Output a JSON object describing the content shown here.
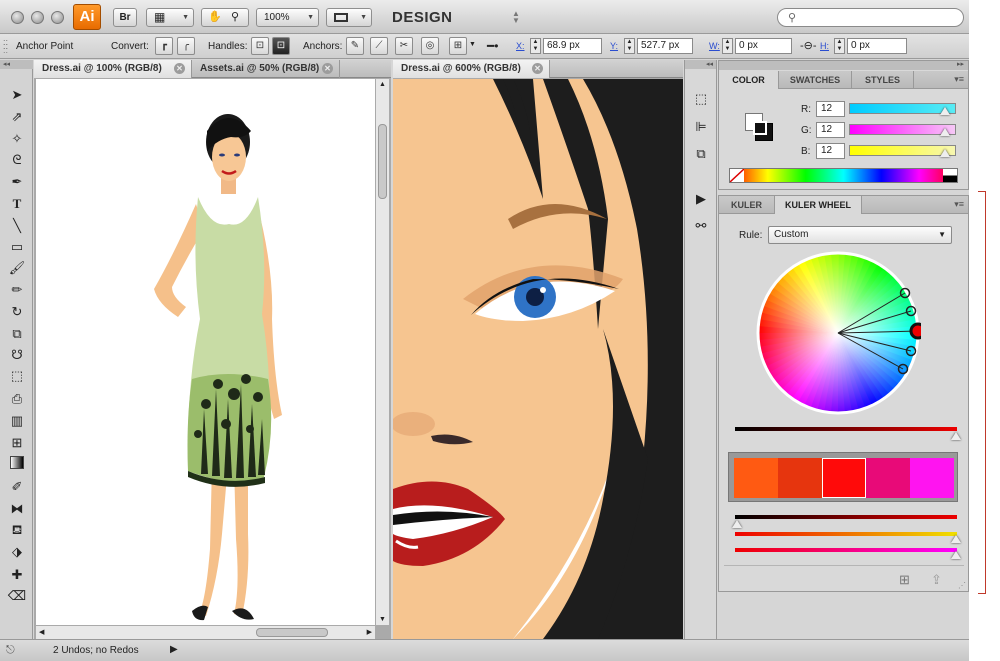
{
  "app": {
    "logo": "Ai",
    "bridge": "Br",
    "zoom": "100%",
    "workspace": "DESIGN",
    "search_placeholder": ""
  },
  "control_bar": {
    "anchor_point": "Anchor Point",
    "convert": "Convert:",
    "handles": "Handles:",
    "anchors": "Anchors:",
    "x_label": "X:",
    "x_value": "68.9 px",
    "y_label": "Y:",
    "y_value": "527.7 px",
    "w_label": "W:",
    "w_value": "0 px",
    "h_label": "H:",
    "h_value": "0 px"
  },
  "documents": [
    {
      "tab": "Dress.ai @ 100% (RGB/8)"
    },
    {
      "tab": "Assets.ai @ 50% (RGB/8)"
    },
    {
      "tab": "Dress.ai @ 600% (RGB/8)"
    }
  ],
  "color_panel": {
    "tabs": [
      "COLOR",
      "SWATCHES",
      "STYLES"
    ],
    "channels": [
      {
        "label": "R:",
        "value": "12"
      },
      {
        "label": "G:",
        "value": "12"
      },
      {
        "label": "B:",
        "value": "12"
      }
    ]
  },
  "kuler_panel": {
    "tabs": [
      "KULER",
      "KULER WHEEL"
    ],
    "rule_label": "Rule:",
    "rule_value": "Custom",
    "swatches": [
      "#ff5a12",
      "#e6350e",
      "#ff0a0a",
      "#e80a78",
      "#ff14f0"
    ]
  },
  "status": {
    "undo_text": "2 Undos; no Redos"
  },
  "colors": {
    "accent": "#ff7f0a",
    "guide": "#c0392b"
  }
}
